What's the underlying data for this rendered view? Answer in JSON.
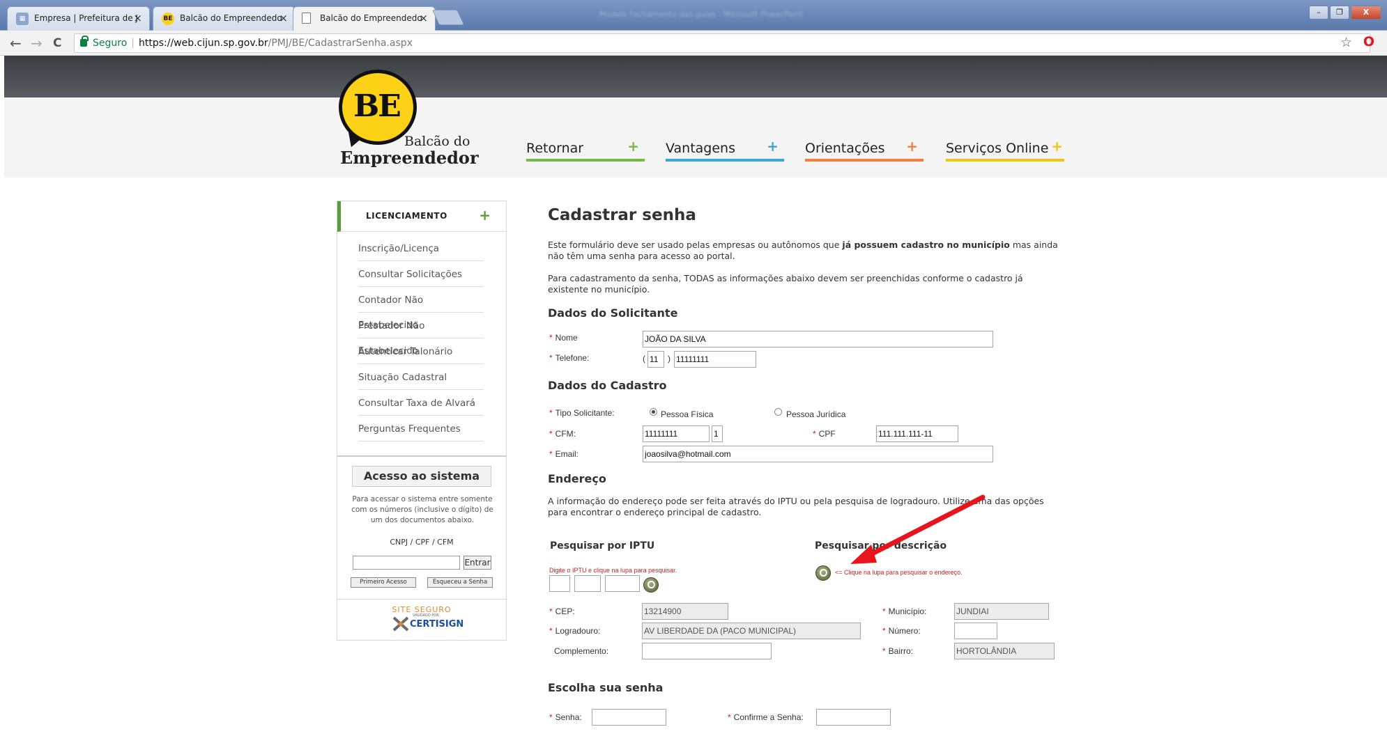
{
  "browser": {
    "tabs": [
      {
        "label": "Empresa | Prefeitura de J",
        "close": "×"
      },
      {
        "label": "Balcão do Empreendedo",
        "close": "×"
      },
      {
        "label": "Balcão do Empreendedo",
        "close": "×"
      }
    ],
    "blurred_title": "Modelo Fechamento das guias - Microsoft PowerPoint",
    "window_controls": {
      "minimize": "–",
      "restore": "❐",
      "close": "X"
    },
    "nav": {
      "back": "←",
      "forward": "→",
      "reload": "C"
    },
    "security_label": "Seguro",
    "url_host": "https://web.cijun.sp.gov.br",
    "url_path": "/PMJ/BE/CadastrarSenha.aspx",
    "star_icon": "☆",
    "opera_icon": "O"
  },
  "header": {
    "logo_mark": "BE",
    "logo_line1": "Balcão do",
    "logo_line2": "Empreendedor",
    "nav": [
      {
        "label": "Retornar",
        "plus": "+",
        "color": "#7ab648"
      },
      {
        "label": "Vantagens",
        "plus": "+",
        "color": "#3aa6d8"
      },
      {
        "label": "Orientações",
        "plus": "+",
        "color": "#f07f3c"
      },
      {
        "label": "Serviços Online",
        "plus": "+",
        "color": "#f2c417"
      }
    ]
  },
  "sidebar": {
    "title": "LICENCIAMENTO",
    "plus": "+",
    "items": [
      "Inscrição/Licença",
      "Consultar Solicitações",
      "Contador Não Estabelecido",
      "Prestador Não Estabelecido",
      "Autenticar Talonário",
      "Situação Cadastral",
      "Consultar Taxa de Alvará",
      "Perguntas Frequentes"
    ],
    "access": {
      "title": "Acesso ao sistema",
      "text": "Para acessar o sistema entre somente com os números (inclusive o dígito) de um dos documentos abaixo.",
      "docs": "CNPJ / CPF / CFM",
      "enter": "Entrar",
      "first_access": "Primeiro Acesso",
      "forgot": "Esqueceu a Senha"
    },
    "seal": {
      "top": "SITE SEGURO",
      "sub": "VALIDADO POR",
      "name": "CERTISIGN"
    }
  },
  "form": {
    "title": "Cadastrar senha",
    "intro1_a": "Este formulário deve ser usado pelas empresas ou autônomos que ",
    "intro1_b": "já possuem cadastro no município",
    "intro1_c": " mas ainda não têm uma senha para acesso ao portal.",
    "intro2": "Para cadastramento da senha, TODAS as informações abaixo devem ser preenchidas conforme o cadastro já existente no município.",
    "required_mark": "*",
    "solicitante": {
      "heading": "Dados do Solicitante",
      "nome_label": "Nome",
      "nome": "JOÃO DA SILVA",
      "telefone_label": "Telefone:",
      "paren_open": "(",
      "paren_close": ")",
      "ddd": "11",
      "telefone": "11111111"
    },
    "cadastro": {
      "heading": "Dados do Cadastro",
      "tipo_label": "Tipo Solicitante:",
      "pf": "Pessoa Física",
      "pj": "Pessoa Jurídica",
      "cfm_label": "CFM:",
      "cfm": "11111111",
      "cfm_digit": "1",
      "cpf_label": "CPF",
      "cpf": "111.111.111-11",
      "email_label": "Email:",
      "email": "joaosilva@hotmail.com"
    },
    "endereco": {
      "heading": "Endereço",
      "text": "A informação do endereço pode ser feita através do IPTU ou pela pesquisa de logradouro. Utilize uma das opções para encontrar o endereço principal de cadastro.",
      "iptu_heading": "Pesquisar por IPTU",
      "iptu_hint": "Digite o IPTU e clique na lupa para pesquisar.",
      "desc_heading": "Pesquisar por descrição",
      "desc_hint": "<= Clique na lupa para pesquisar o endereço.",
      "cep_label": "CEP:",
      "cep": "13214900",
      "logradouro_label": "Logradouro:",
      "logradouro": "AV  LIBERDADE DA (PACO MUNICIPAL)",
      "complemento_label": "Complemento:",
      "complemento": "",
      "municipio_label": "Município:",
      "municipio": "JUNDIAI",
      "numero_label": "Número:",
      "numero": "",
      "bairro_label": "Bairro:",
      "bairro": "HORTOLÂNDIA"
    },
    "senha": {
      "heading": "Escolha sua senha",
      "senha_label": "Senha:",
      "confirm_label": "Confirme a Senha:"
    }
  },
  "colors": {
    "arrow": "#e8141b",
    "accent_green": "#5a9b3b",
    "required": "#c51f1f"
  }
}
